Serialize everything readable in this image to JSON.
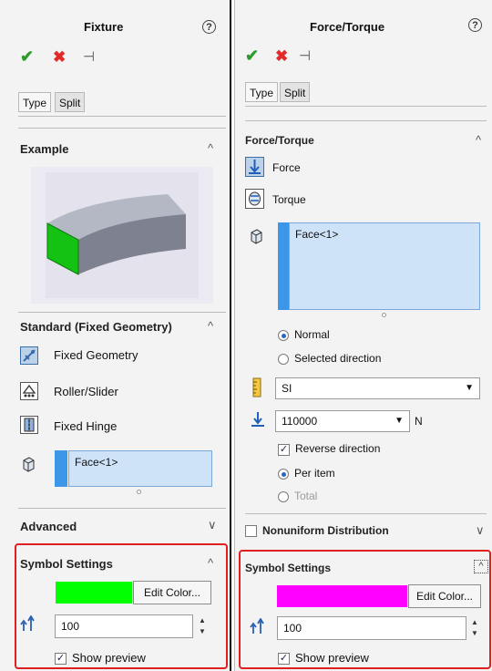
{
  "left": {
    "title": "Fixture",
    "tabs": [
      "Type",
      "Split"
    ],
    "example": {
      "title": "Example"
    },
    "standard": {
      "title": "Standard (Fixed Geometry)",
      "items": [
        {
          "label": "Fixed Geometry",
          "icon": "fixed-geometry-icon"
        },
        {
          "label": "Roller/Slider",
          "icon": "roller-slider-icon"
        },
        {
          "label": "Fixed Hinge",
          "icon": "fixed-hinge-icon"
        }
      ],
      "selection": "Face<1>"
    },
    "advanced": {
      "title": "Advanced"
    },
    "symbol": {
      "title": "Symbol Settings",
      "color": "#00ff00",
      "edit_color": "Edit Color...",
      "size": "100",
      "show_preview": "Show preview"
    }
  },
  "right": {
    "title": "Force/Torque",
    "tabs": [
      "Type",
      "Split"
    ],
    "section": {
      "title": "Force/Torque",
      "options": [
        {
          "label": "Force",
          "icon": "force-icon"
        },
        {
          "label": "Torque",
          "icon": "torque-icon"
        }
      ],
      "selection": "Face<1>",
      "radios": [
        {
          "label": "Normal",
          "checked": true
        },
        {
          "label": "Selected direction",
          "checked": false
        }
      ],
      "units": "SI",
      "value": "110000",
      "unit_label": "N",
      "reverse": "Reverse direction",
      "distribution": [
        {
          "label": "Per item",
          "checked": true
        },
        {
          "label": "Total",
          "checked": false
        }
      ]
    },
    "nonuniform": "Nonuniform Distribution",
    "symbol": {
      "title": "Symbol Settings",
      "color": "#ff00ff",
      "edit_color": "Edit Color...",
      "size": "100",
      "show_preview": "Show preview"
    }
  },
  "glyphs": {
    "help": "?",
    "ok": "✔",
    "cancel": "✖",
    "pin": "⊣",
    "chev_up": "^",
    "chev_down": "∨",
    "dropdown": "▼",
    "spin_up": "▲",
    "spin_down": "▼",
    "check": "✓"
  }
}
